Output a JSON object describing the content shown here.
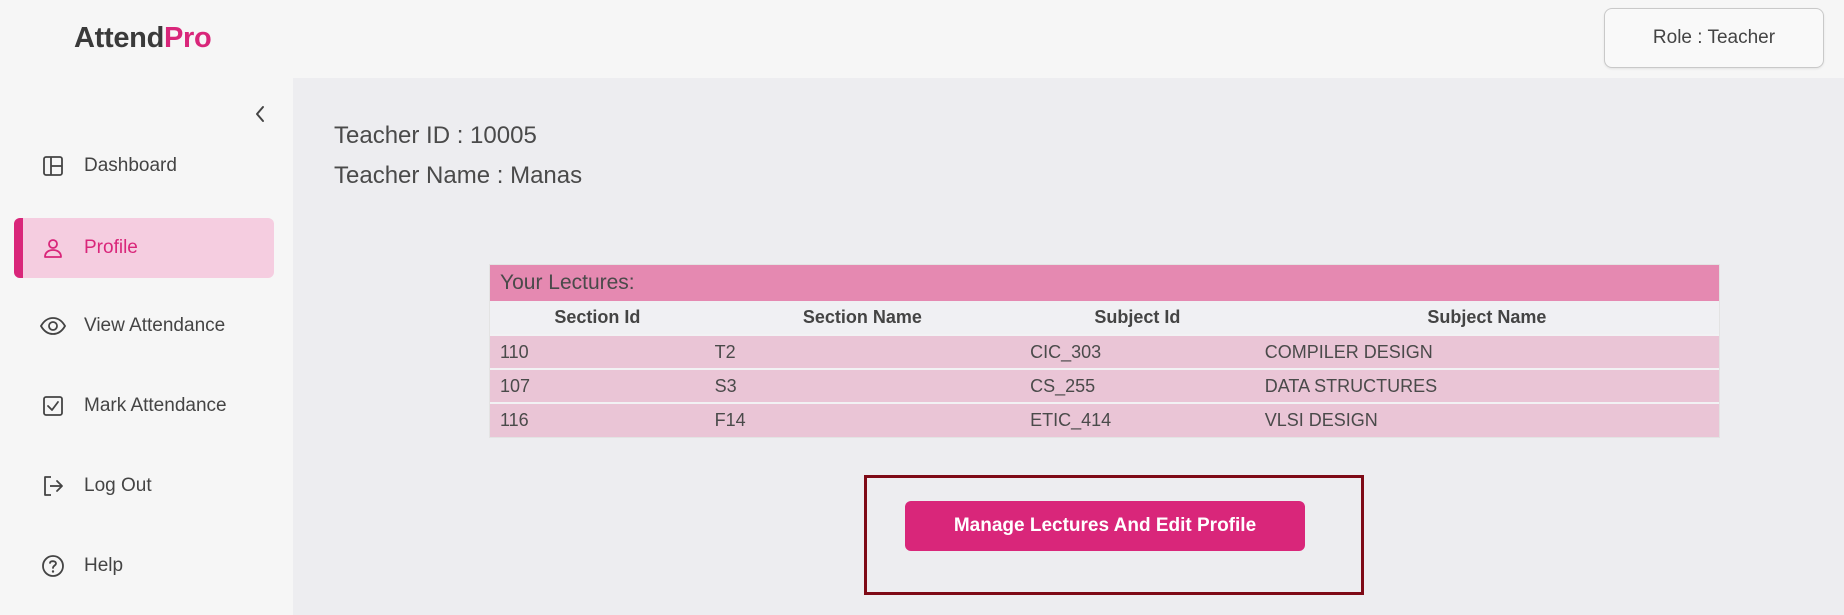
{
  "app": {
    "logo_part1": "Attend",
    "logo_part2": "Pro",
    "brand_color": "#d9267a"
  },
  "header": {
    "role_label": "Role : Teacher"
  },
  "sidebar": {
    "collapse_icon": "chevron-left-icon",
    "items": [
      {
        "label": "Dashboard",
        "icon": "dashboard-icon",
        "active": false
      },
      {
        "label": "Profile",
        "icon": "user-icon",
        "active": true
      },
      {
        "label": "View Attendance",
        "icon": "eye-icon",
        "active": false
      },
      {
        "label": "Mark Attendance",
        "icon": "checkbox-icon",
        "active": false
      },
      {
        "label": "Log Out",
        "icon": "logout-icon",
        "active": false
      },
      {
        "label": "Help",
        "icon": "help-icon",
        "active": false
      }
    ]
  },
  "main": {
    "teacher_id": "Teacher ID : 10005",
    "teacher_name": "Teacher Name : Manas",
    "lectures": {
      "caption": "Your Lectures:",
      "columns": [
        "Section Id",
        "Section Name",
        "Subject Id",
        "Subject Name"
      ],
      "rows": [
        [
          "110",
          "T2",
          "CIC_303",
          "COMPILER DESIGN"
        ],
        [
          "107",
          "S3",
          "CS_255",
          "DATA STRUCTURES"
        ],
        [
          "116",
          "F14",
          "ETIC_414",
          "VLSI DESIGN"
        ]
      ]
    },
    "manage_button_label": "Manage Lectures And Edit Profile"
  }
}
